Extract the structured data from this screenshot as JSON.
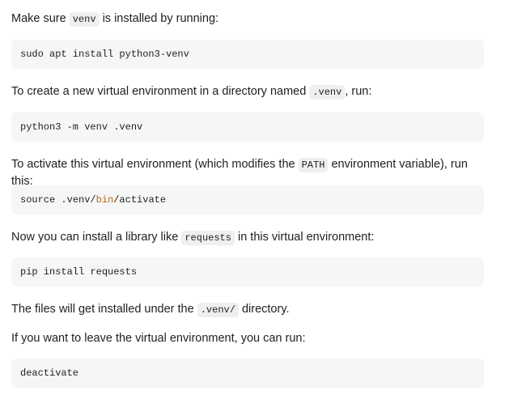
{
  "steps": [
    {
      "text_before": "Make sure ",
      "inline_code": "venv",
      "text_after": " is installed by running:",
      "code_block": "sudo apt install python3-venv"
    },
    {
      "text_before": "To create a new virtual environment in a directory named ",
      "inline_code": ".venv",
      "text_after": ", run:",
      "code_block": "python3 -m venv .venv"
    },
    {
      "text_before": "To activate this virtual environment (which modifies the ",
      "inline_code": "PATH",
      "text_after": " environment variable), run this:",
      "code_block_parts": [
        "source .venv/",
        "bin",
        "/activate"
      ]
    },
    {
      "text_before": "Now you can install a library like ",
      "inline_code": "requests",
      "text_after": " in this virtual environment:",
      "code_block": "pip install requests"
    },
    {
      "text_before": "The files will get installed under the ",
      "inline_code": ".venv/",
      "text_after": " directory."
    },
    {
      "text": "If you want to leave the virtual environment, you can run:",
      "code_block": "deactivate"
    }
  ],
  "colors": {
    "highlight_keyword": "#b8651c",
    "code_background": "#f6f6f6",
    "inline_code_background": "#efefef"
  }
}
